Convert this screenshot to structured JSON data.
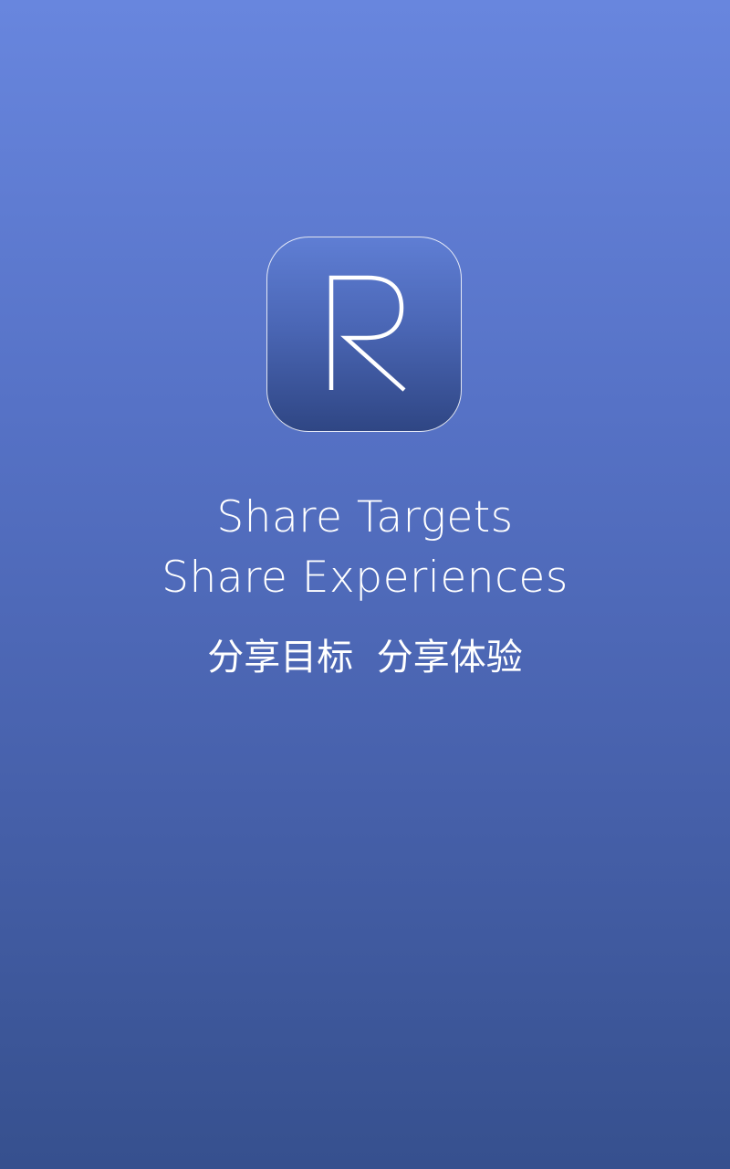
{
  "splash": {
    "logo": {
      "letter": "R",
      "icon": "r-letter-logo-icon"
    },
    "tagline_en": {
      "line1": "Share Targets",
      "line2": "Share Experiences"
    },
    "tagline_zh": "分享目标  分享体验"
  },
  "colors": {
    "background_top": "#6886de",
    "background_bottom": "#36508e",
    "logo_top": "#5f7ed4",
    "logo_bottom": "#2f4684",
    "text": "#ffffff"
  }
}
